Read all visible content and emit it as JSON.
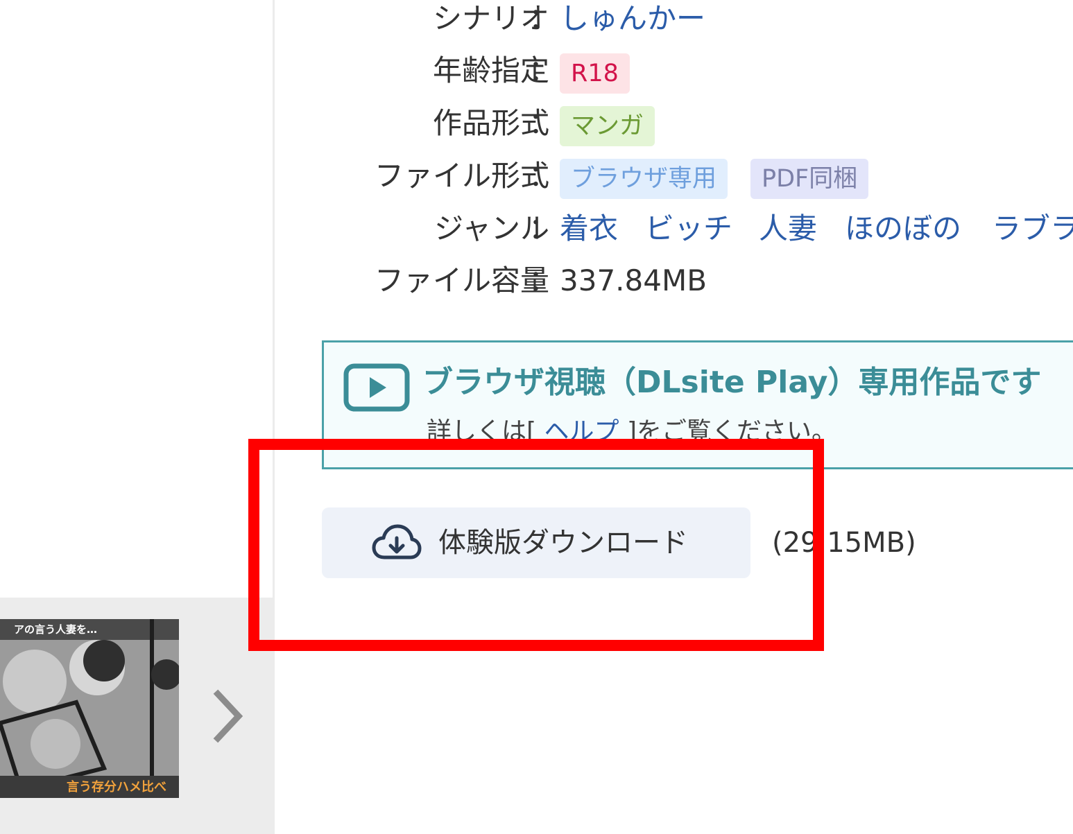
{
  "specs": [
    {
      "label": "シナリオ",
      "value": "しゅんかー"
    },
    {
      "label": "年齢指定",
      "chips": [
        "R18"
      ]
    },
    {
      "label": "作品形式",
      "chips": [
        "マンガ"
      ]
    },
    {
      "label": "ファイル形式",
      "chips": [
        "ブラウザ専用",
        "PDF同梱"
      ]
    },
    {
      "label": "ジャンル",
      "genres": [
        "着衣",
        "ビッチ",
        "人妻",
        "ほのぼの",
        "ラブラ"
      ]
    },
    {
      "label": "ファイル容量",
      "value": "337.84MB"
    }
  ],
  "colon": "：",
  "notice": {
    "title": "ブラウザ視聴（DLsite Play）専用作品です",
    "sub_prefix": "詳しくは[",
    "help_link": " ヘルプ ",
    "sub_suffix": "]をご覧ください。"
  },
  "trial": {
    "button_label": "体験版ダウンロード",
    "size": "(29.15MB)"
  },
  "thumbnail": {
    "caption_top": "アの言う人妻を…",
    "caption_bottom": "言う存分ハメ比べ"
  },
  "colors": {
    "annotation": "#ff0000",
    "notice_border": "#4aa1a8",
    "link": "#2b5ca9"
  }
}
